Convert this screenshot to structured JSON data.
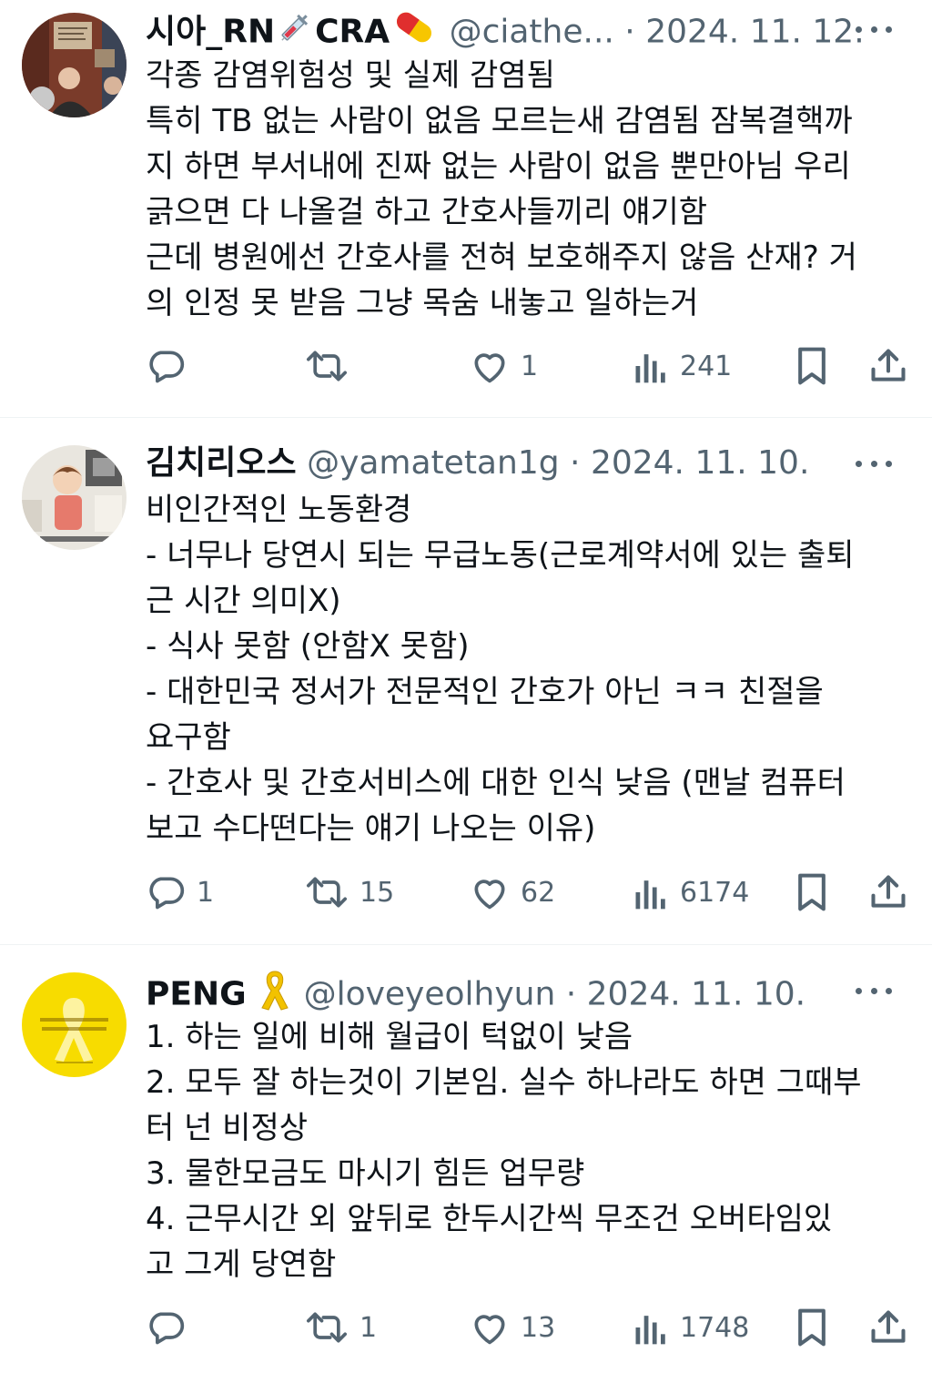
{
  "tweets": [
    {
      "name": "시아_RN",
      "name_suffix": "CRA",
      "handle": "@ciathe...",
      "separator": "·",
      "date": "2024. 11. 12.",
      "text": "각종 감염위험성 및 실제 감염됨\n특히 TB 없는 사람이 없음 모르는새 감염됨 잠복결핵까\n지 하면 부서내에 진짜 없는 사람이 없음 뿐만아님 우리\n긁으면 다 나올걸 하고 간호사들끼리 얘기함\n근데 병원에선 간호사를 전혀 보호해주지 않음 산재? 거\n의 인정 못 받음 그냥 목숨 내놓고 일하는거",
      "replies": "",
      "retweets": "",
      "likes": "1",
      "views": "241"
    },
    {
      "name": "김치리오스",
      "handle": "@yamatetan1g",
      "separator": "·",
      "date": "2024. 11. 10.",
      "text": "비인간적인 노동환경\n- 너무나 당연시 되는 무급노동(근로계약서에 있는 출퇴\n근 시간 의미X)\n- 식사 못함 (안함X 못함)\n- 대한민국 정서가 전문적인 간호가 아닌 ㅋㅋ 친절을\n요구함\n- 간호사 및 간호서비스에 대한 인식 낮음 (맨날 컴퓨터\n보고 수다떤다는 얘기 나오는 이유)",
      "replies": "1",
      "retweets": "15",
      "likes": "62",
      "views": "6174"
    },
    {
      "name": "PENG",
      "handle": "@loveyeolhyun",
      "separator": "·",
      "date": "2024. 11. 10.",
      "text": "1. 하는 일에 비해 월급이 턱없이 낮음\n2. 모두 잘 하는것이 기본임. 실수 하나라도 하면 그때부\n터 넌 비정상\n3. 물한모금도 마시기 힘든 업무량\n4. 근무시간 외 앞뒤로 한두시간씩 무조건 오버타임있\n고 그게 당연함",
      "replies": "",
      "retweets": "1",
      "likes": "13",
      "views": "1748"
    }
  ],
  "icons": {
    "reply": "speech-bubble-icon",
    "retweet": "retweet-arrows-icon",
    "like": "heart-icon",
    "views": "bar-chart-icon",
    "bookmark": "bookmark-icon",
    "share": "share-upload-icon",
    "more": "more-dots-icon",
    "syringe": "syringe-emoji",
    "pill": "pill-emoji",
    "ribbon": "yellow-ribbon-emoji"
  },
  "colors": {
    "text": "#0f1419",
    "secondary": "#536471",
    "divider": "#eff3f4",
    "ribbon_yellow": "#f5d20a"
  }
}
